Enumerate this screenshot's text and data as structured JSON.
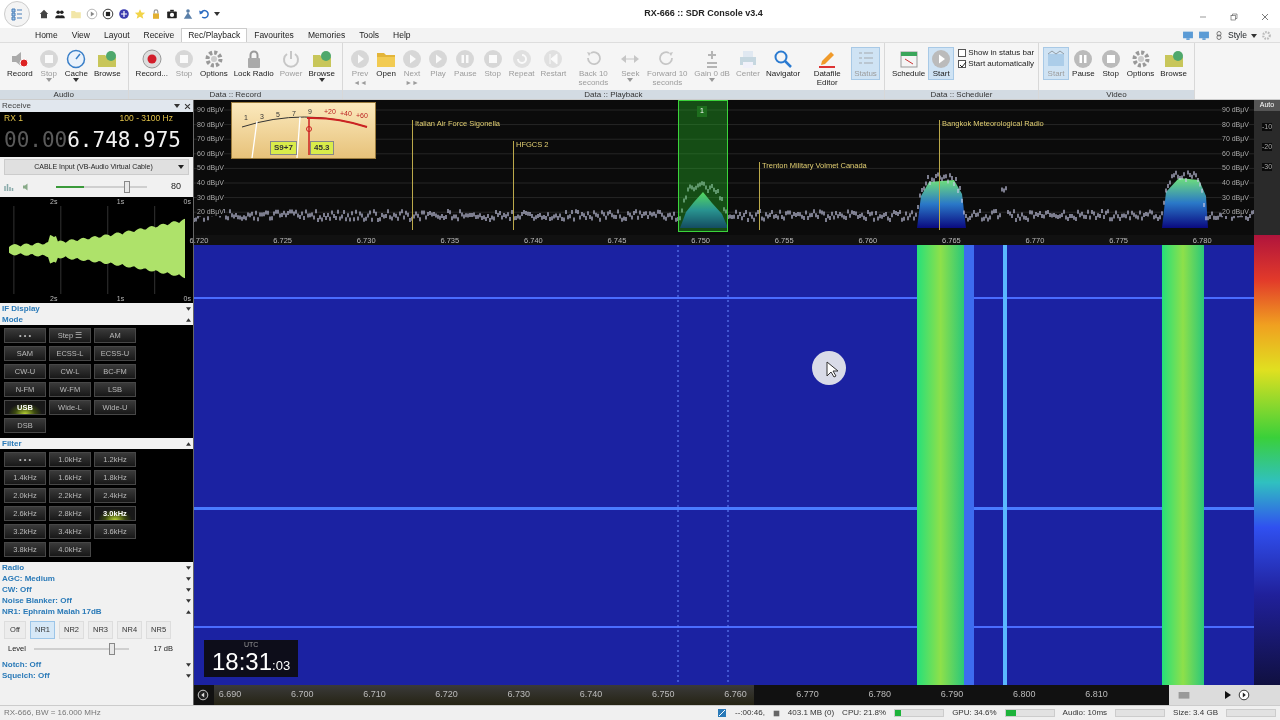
{
  "window": {
    "title": "RX-666 :: SDR Console v3.4"
  },
  "menu": {
    "tabs": [
      {
        "label": "Home",
        "selected": false
      },
      {
        "label": "View",
        "selected": false
      },
      {
        "label": "Layout",
        "selected": false
      },
      {
        "label": "Receive",
        "selected": false
      },
      {
        "label": "Rec/Playback",
        "selected": true
      },
      {
        "label": "Favourites",
        "selected": false
      },
      {
        "label": "Memories",
        "selected": false
      },
      {
        "label": "Tools",
        "selected": false
      },
      {
        "label": "Help",
        "selected": false
      }
    ],
    "style_menu": "Style"
  },
  "ribbon": {
    "groups": [
      {
        "title": "Audio",
        "items": [
          {
            "kind": "button",
            "label": "Record",
            "disabled": false,
            "active": false,
            "dropdown": false
          },
          {
            "kind": "button",
            "label": "Stop",
            "disabled": true,
            "active": false,
            "dropdown": true
          },
          {
            "kind": "button",
            "label": "Cache",
            "disabled": false,
            "active": false,
            "dropdown": true
          },
          {
            "kind": "button",
            "label": "Browse",
            "disabled": false,
            "active": false,
            "dropdown": false
          }
        ]
      },
      {
        "title": "Data :: Record",
        "items": [
          {
            "kind": "button",
            "label": "Record...",
            "disabled": false,
            "active": false,
            "dropdown": false
          },
          {
            "kind": "button",
            "label": "Stop",
            "disabled": true,
            "active": false,
            "dropdown": false
          },
          {
            "kind": "button",
            "label": "Options",
            "disabled": false,
            "active": false,
            "dropdown": false
          },
          {
            "kind": "button",
            "label": "Lock Radio",
            "disabled": false,
            "active": false,
            "dropdown": false
          },
          {
            "kind": "button",
            "label": "Power",
            "disabled": true,
            "active": false,
            "dropdown": false
          },
          {
            "kind": "button",
            "label": "Browse",
            "disabled": false,
            "active": false,
            "dropdown": true
          }
        ]
      },
      {
        "title": "Data :: Playback",
        "items": [
          {
            "kind": "button",
            "label": "Prev",
            "sub": "◄◄",
            "disabled": true,
            "active": false,
            "dropdown": false
          },
          {
            "kind": "button",
            "label": "Open",
            "disabled": false,
            "active": false,
            "dropdown": false
          },
          {
            "kind": "button",
            "label": "Next",
            "sub": "►►",
            "disabled": true,
            "active": false,
            "dropdown": false
          },
          {
            "kind": "button",
            "label": "Play",
            "disabled": true,
            "active": false,
            "dropdown": false
          },
          {
            "kind": "button",
            "label": "Pause",
            "disabled": true,
            "active": false,
            "dropdown": false
          },
          {
            "kind": "button",
            "label": "Stop",
            "disabled": true,
            "active": false,
            "dropdown": false
          },
          {
            "kind": "button",
            "label": "Repeat",
            "disabled": true,
            "active": false,
            "dropdown": false
          },
          {
            "kind": "button",
            "label": "Restart",
            "disabled": true,
            "active": false,
            "dropdown": false
          },
          {
            "kind": "button",
            "label": "Back 10 seconds",
            "disabled": true,
            "active": false,
            "dropdown": false
          },
          {
            "kind": "button",
            "label": "Seek",
            "disabled": true,
            "active": false,
            "dropdown": true
          },
          {
            "kind": "button",
            "label": "Forward 10 seconds",
            "disabled": true,
            "active": false,
            "dropdown": false
          },
          {
            "kind": "button",
            "label": "Gain 0 dB",
            "disabled": true,
            "active": false,
            "dropdown": true
          },
          {
            "kind": "button",
            "label": "Center",
            "disabled": true,
            "active": false,
            "dropdown": false
          },
          {
            "kind": "button",
            "label": "Navigator",
            "disabled": false,
            "active": false,
            "dropdown": false
          },
          {
            "kind": "button",
            "label": "Datafile Editor",
            "disabled": false,
            "active": false,
            "dropdown": false
          },
          {
            "kind": "button",
            "label": "Status",
            "disabled": true,
            "active": true,
            "dropdown": false
          }
        ]
      },
      {
        "title": "Data :: Scheduler",
        "items": [
          {
            "kind": "button",
            "label": "Schedule",
            "disabled": false,
            "active": false,
            "dropdown": false
          },
          {
            "kind": "button",
            "label": "Start",
            "disabled": false,
            "active": true,
            "dropdown": false
          },
          {
            "kind": "checks",
            "options": [
              {
                "label": "Show in status bar",
                "checked": false
              },
              {
                "label": "Start automatically",
                "checked": true
              }
            ]
          }
        ]
      },
      {
        "title": "Video",
        "items": [
          {
            "kind": "button",
            "label": "Start",
            "disabled": true,
            "active": true,
            "dropdown": false
          },
          {
            "kind": "button",
            "label": "Pause",
            "disabled": false,
            "active": false,
            "dropdown": false
          },
          {
            "kind": "button",
            "label": "Stop",
            "disabled": false,
            "active": false,
            "dropdown": false
          },
          {
            "kind": "button",
            "label": "Options",
            "disabled": false,
            "active": false,
            "dropdown": false
          },
          {
            "kind": "button",
            "label": "Browse",
            "disabled": false,
            "active": false,
            "dropdown": false
          }
        ]
      }
    ]
  },
  "receive_panel": {
    "title": "Receive",
    "receiver": "RX 1",
    "bandwidth": "100 - 3100 Hz",
    "frequency_dim": "00.00",
    "frequency": "6.748.975",
    "audio_device": "CABLE Input (VB-Audio Virtual Cable)",
    "volume": {
      "level": 0.78,
      "reading": "80"
    },
    "scope": {
      "top_ticks": [
        "2s",
        "1s",
        "0s"
      ],
      "bottom_ticks": [
        "2s",
        "1s",
        "0s"
      ]
    },
    "sections": [
      {
        "kind": "header",
        "title": "IF Display",
        "expanded": false
      },
      {
        "kind": "grid",
        "title": "Mode",
        "expanded": true,
        "buttons": [
          {
            "label": "• • •",
            "selected": false
          },
          {
            "label": "Step ☰",
            "selected": false
          },
          {
            "label": "AM",
            "selected": false
          },
          {
            "label": "SAM",
            "selected": false
          },
          {
            "label": "ECSS-L",
            "selected": false
          },
          {
            "label": "ECSS-U",
            "selected": false
          },
          {
            "label": "CW-U",
            "selected": false
          },
          {
            "label": "CW-L",
            "selected": false
          },
          {
            "label": "BC-FM",
            "selected": false
          },
          {
            "label": "N-FM",
            "selected": false
          },
          {
            "label": "W-FM",
            "selected": false
          },
          {
            "label": "LSB",
            "selected": false
          },
          {
            "label": "USB",
            "selected": true
          },
          {
            "label": "Wide-L",
            "selected": false
          },
          {
            "label": "Wide-U",
            "selected": false
          },
          {
            "label": "DSB",
            "selected": false
          }
        ]
      },
      {
        "kind": "grid",
        "title": "Filter",
        "expanded": true,
        "buttons": [
          {
            "label": "• • •",
            "selected": false
          },
          {
            "label": "1.0kHz",
            "selected": false
          },
          {
            "label": "1.2kHz",
            "selected": false
          },
          {
            "label": "1.4kHz",
            "selected": false
          },
          {
            "label": "1.6kHz",
            "selected": false
          },
          {
            "label": "1.8kHz",
            "selected": false
          },
          {
            "label": "2.0kHz",
            "selected": false
          },
          {
            "label": "2.2kHz",
            "selected": false
          },
          {
            "label": "2.4kHz",
            "selected": false
          },
          {
            "label": "2.6kHz",
            "selected": false
          },
          {
            "label": "2.8kHz",
            "selected": false
          },
          {
            "label": "3.0kHz",
            "selected": true
          },
          {
            "label": "3.2kHz",
            "selected": false
          },
          {
            "label": "3.4kHz",
            "selected": false
          },
          {
            "label": "3.6kHz",
            "selected": false
          },
          {
            "label": "3.8kHz",
            "selected": false
          },
          {
            "label": "4.0kHz",
            "selected": false
          }
        ]
      },
      {
        "kind": "header",
        "title": "Radio",
        "expanded": false
      },
      {
        "kind": "header",
        "title": "AGC: Medium",
        "expanded": false
      },
      {
        "kind": "header",
        "title": "CW: Off",
        "expanded": false
      },
      {
        "kind": "header",
        "title": "Noise Blanker: Off",
        "expanded": false
      },
      {
        "kind": "nr",
        "title": "NR1: Ephraim Malah 17dB",
        "expanded": true,
        "buttons": [
          {
            "label": "Off",
            "selected": false
          },
          {
            "label": "NR1",
            "selected": true
          },
          {
            "label": "NR2",
            "selected": false
          },
          {
            "label": "NR3",
            "selected": false
          },
          {
            "label": "NR4",
            "selected": false
          },
          {
            "label": "NR5",
            "selected": false
          }
        ],
        "level_label": "Level",
        "level": 0.82,
        "reading": "17 dB"
      },
      {
        "kind": "header",
        "title": "Notch: Off",
        "expanded": false
      },
      {
        "kind": "header",
        "title": "Squelch: Off",
        "expanded": false
      }
    ]
  },
  "spectrum": {
    "y_labels": [
      "90 dBμV",
      "80 dBμV",
      "70 dBμV",
      "60 dBμV",
      "50 dBμV",
      "40 dBμV",
      "30 dBμV",
      "20 dBμV"
    ],
    "right_labels": [
      "90 dBμV",
      "80 dBμV",
      "70 dBμV",
      "60 dBμV",
      "50 dBμV",
      "40 dBμV",
      "30 dBμV",
      "20 dBμV"
    ],
    "auto_button": "Auto",
    "scale_labels": [
      "-10",
      "-20",
      "-30"
    ],
    "x_ticks": [
      "6.720",
      "6.725",
      "6.730",
      "6.735",
      "6.740",
      "6.745",
      "6.750",
      "6.755",
      "6.760",
      "6.765",
      "6.770",
      "6.775",
      "6.780"
    ],
    "stations": [
      {
        "label": "Italian Air Force Sigonella"
      },
      {
        "label": "HFGCS 2"
      },
      {
        "label": "Trenton Military Volmet Canada"
      },
      {
        "label": "Bangkok Meteorological Radio"
      }
    ],
    "marker": "1",
    "s_meter": {
      "scale": [
        "1",
        "3",
        "5",
        "7",
        "9",
        "+20",
        "+40",
        "+60"
      ],
      "s_reading": "S9+7",
      "db_reading": "45.3"
    }
  },
  "waterfall": {
    "clock": {
      "zone": "UTC",
      "hhmm": "18:31",
      "seconds": ":03"
    },
    "x_ticks": [
      "6.690",
      "6.700",
      "6.710",
      "6.720",
      "6.730",
      "6.740",
      "6.750",
      "6.760",
      "6.770",
      "6.780",
      "6.790",
      "6.800",
      "6.810"
    ]
  },
  "status_bar": {
    "left": "RX-666, BW = 16.000 MHz",
    "time": "--:00:46,",
    "memory": "403.1 MB (0)",
    "cpu": {
      "text": "CPU: 21.8%",
      "level": 0.12
    },
    "gpu": {
      "text": "GPU: 34.6%",
      "level": 0.22
    },
    "audio": "Audio: 10ms",
    "size": "Size: 3.4 GB"
  }
}
